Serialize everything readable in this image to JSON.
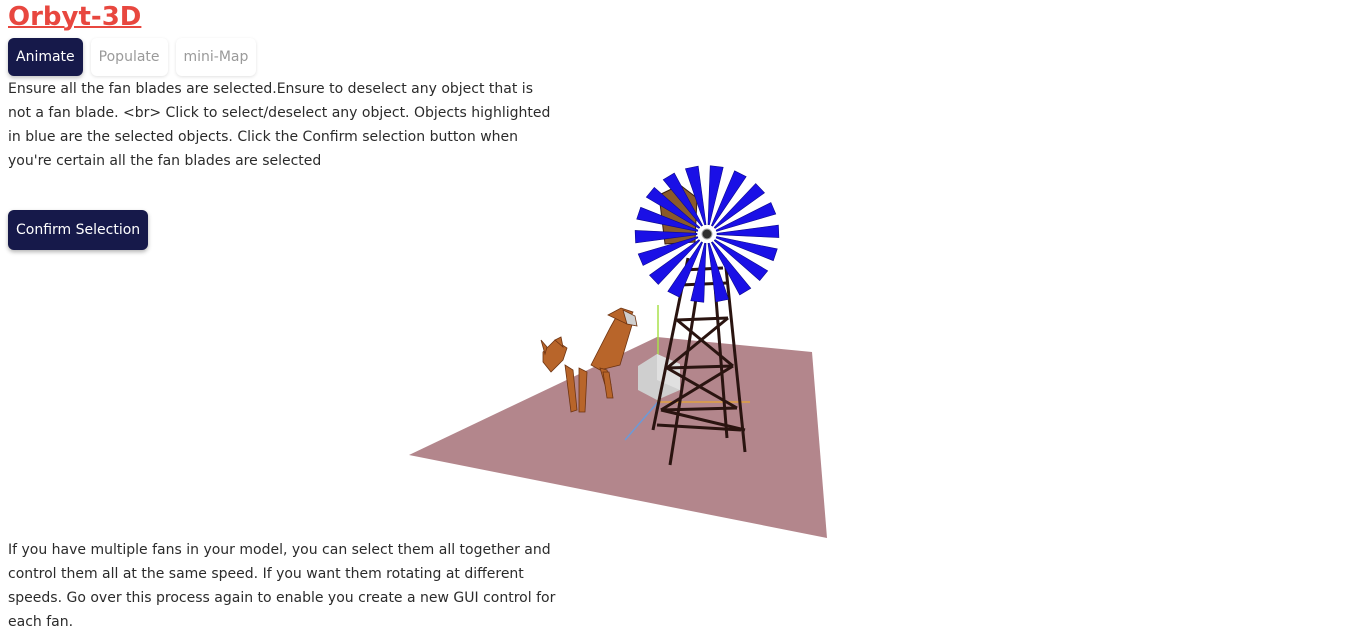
{
  "app": {
    "title": "Orbyt-3D"
  },
  "tabs": [
    {
      "label": "Animate",
      "active": true
    },
    {
      "label": "Populate",
      "active": false
    },
    {
      "label": "mini-Map",
      "active": false
    }
  ],
  "instructions": {
    "text": "Ensure all the fan blades are selected.Ensure to deselect any object that is not a fan blade. <br> Click to select/deselect any object. Objects highlighted in blue are the selected objects. Click the Confirm selection button when you're certain all the fan blades are selected"
  },
  "confirm_button": {
    "label": "Confirm Selection"
  },
  "footer": {
    "text": "If you have multiple fans in your model, you can select them all together and control them all at the same speed. If you want them rotating at different speeds. Go over this process again to enable you create a new GUI control for each fan."
  },
  "scene": {
    "ground_color": "#b3868c",
    "selected_color": "#1a10e6",
    "tower_color": "#2a1410",
    "fox_color": "#b8652a",
    "box_color": "#d4d4d4"
  }
}
